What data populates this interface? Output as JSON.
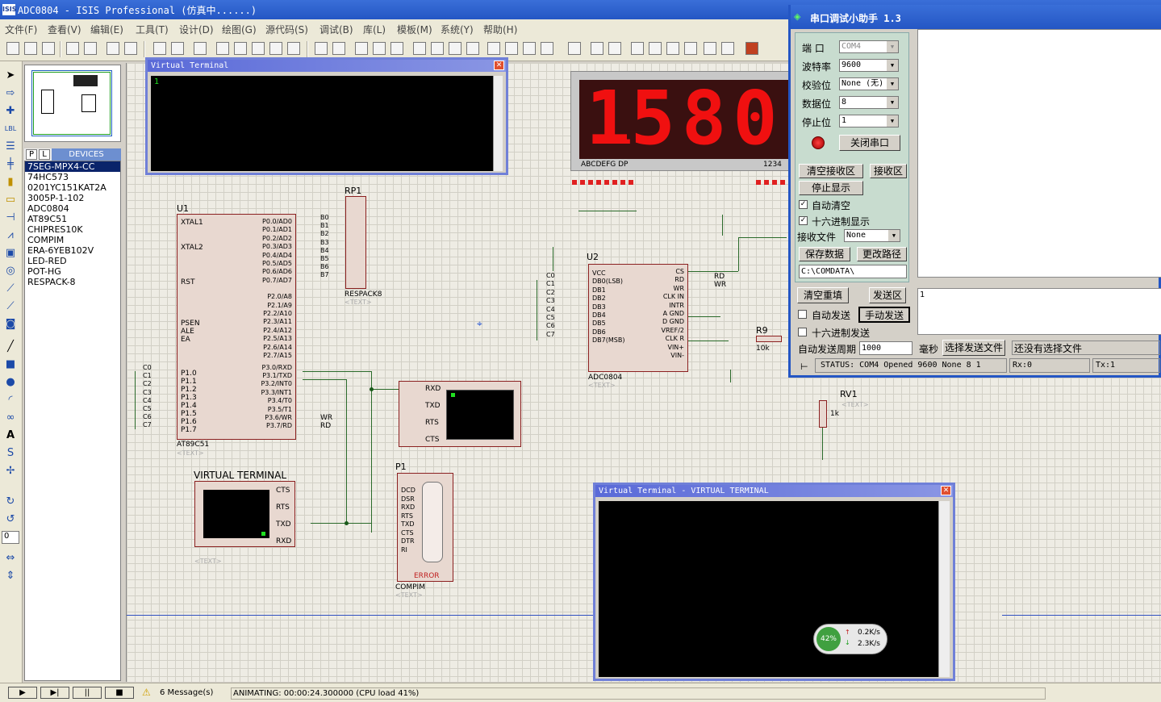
{
  "window": {
    "title": "ADC0804 - ISIS Professional (仿真中......)",
    "logo": "ISIS"
  },
  "menu": [
    "文件(F)",
    "查看(V)",
    "编辑(E)",
    "工具(T)",
    "设计(D)",
    "绘图(G)",
    "源代码(S)",
    "调试(B)",
    "库(L)",
    "模板(M)",
    "系统(Y)",
    "帮助(H)"
  ],
  "devices": {
    "tabs": [
      "P",
      "L"
    ],
    "header": "DEVICES",
    "items": [
      "7SEG-MPX4-CC",
      "74HC573",
      "0201YC151KAT2A",
      "3005P-1-102",
      "ADC0804",
      "AT89C51",
      "CHIPRES10K",
      "COMPIM",
      "ERA-6YEB102V",
      "LED-RED",
      "POT-HG",
      "RESPACK-8"
    ],
    "selected": "7SEG-MPX4-CC"
  },
  "zoom_value": "0",
  "vt_top": {
    "title": "Virtual Terminal",
    "content": "1"
  },
  "vt_bottom": {
    "title": "Virtual Terminal - VIRTUAL TERMINAL"
  },
  "display": {
    "digits": "1580",
    "seg_labels": "ABCDEFG  DP",
    "digit_labels": "1234",
    "decimal_after": 1
  },
  "schematic": {
    "u1_label": "U1",
    "u1_part": "AT89C51",
    "u2_label": "U2",
    "u2_part": "ADC0804",
    "rp1_label": "RP1",
    "rp1_part": "RESPACK8",
    "p1_label": "P1",
    "p1_part": "COMPIM",
    "rv1_label": "RV1",
    "rv1_value": "1k",
    "r9_label": "R9",
    "r9_value": "10k",
    "vt_label": "VIRTUAL TERMINAL",
    "text_placeholder": "<TEXT>",
    "u1_left_pins": [
      "XTAL1",
      "XTAL2",
      "RST",
      "PSEN",
      "ALE",
      "EA",
      "P1.0",
      "P1.1",
      "P1.2",
      "P1.3",
      "P1.4",
      "P1.5",
      "P1.6",
      "P1.7"
    ],
    "u1_right_pins": [
      "P0.0/AD0",
      "P0.1/AD1",
      "P0.2/AD2",
      "P0.3/AD3",
      "P0.4/AD4",
      "P0.5/AD5",
      "P0.6/AD6",
      "P0.7/AD7",
      "P2.0/A8",
      "P2.1/A9",
      "P2.2/A10",
      "P2.3/A11",
      "P2.4/A12",
      "P2.5/A13",
      "P2.6/A14",
      "P2.7/A15",
      "P3.0/RXD",
      "P3.1/TXD",
      "P3.2/INT0",
      "P3.3/INT1",
      "P3.4/T0",
      "P3.5/T1",
      "P3.6/WR",
      "P3.7/RD"
    ],
    "u2_left_pins": [
      "VCC",
      "DB0(LSB)",
      "DB1",
      "DB2",
      "DB3",
      "DB4",
      "DB5",
      "DB6",
      "DB7(MSB)"
    ],
    "u2_right_pins": [
      "CS",
      "RD",
      "WR",
      "CLK IN",
      "INTR",
      "A GND",
      "D GND",
      "VREF/2",
      "CLK R",
      "VIN+",
      "VIN-"
    ],
    "p1_pins": [
      "DCD",
      "DSR",
      "RXD",
      "RTS",
      "TXD",
      "CTS",
      "DTR",
      "RI"
    ],
    "vt_pins": [
      "RXD",
      "TXD",
      "RTS",
      "CTS"
    ],
    "vt2_pins": [
      "CTS",
      "RTS",
      "TXD",
      "RXD"
    ],
    "c_labels": [
      "C0",
      "C1",
      "C2",
      "C3",
      "C4",
      "C5",
      "C6",
      "C7"
    ],
    "b_labels": [
      "B0",
      "B1",
      "B2",
      "B3",
      "B4",
      "B5",
      "B6",
      "B7"
    ],
    "error": "ERROR",
    "wr": "WR",
    "rd": "RD"
  },
  "serial": {
    "title": "串口调试小助手 1.3",
    "port_label": "端  口",
    "port": "COM4",
    "baud_label": "波特率",
    "baud": "9600",
    "parity_label": "校验位",
    "parity": "None (无)",
    "data_label": "数据位",
    "data": "8",
    "stop_label": "停止位",
    "stop": "1",
    "close_port": "关闭串口",
    "clear_recv": "清空接收区",
    "recv_area": "接收区",
    "stop_display": "停止显示",
    "auto_clear": "自动清空",
    "hex_display": "十六进制显示",
    "recv_file_label": "接收文件",
    "recv_file": "None",
    "save_data": "保存数据",
    "change_path": "更改路径",
    "path": "C:\\COMDATA\\",
    "clear_send": "清空重填",
    "send_area": "发送区",
    "send_text": "1",
    "auto_send": "自动发送",
    "manual_send": "手动发送",
    "hex_send": "十六进制发送",
    "period_label": "自动发送周期",
    "period": "1000",
    "ms": "毫秒",
    "choose_file": "选择发送文件",
    "no_file": "还没有选择文件",
    "status": "STATUS: COM4 Opened 9600 None 8 1",
    "rx": "Rx:0",
    "tx": "Tx:1"
  },
  "netspeed": {
    "percent": "42%",
    "up": "0.2K/s",
    "down": "2.3K/s"
  },
  "status": {
    "messages": "6 Message(s)",
    "animating": "ANIMATING: 00:00:24.300000 (CPU load 41%)"
  }
}
